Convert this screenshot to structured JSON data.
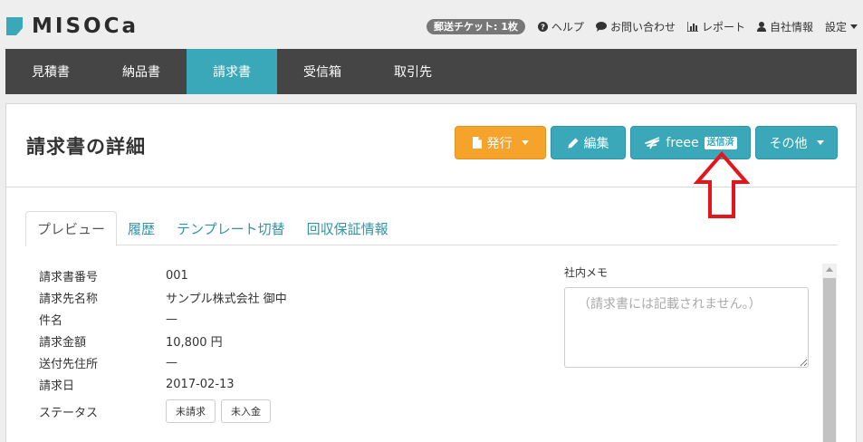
{
  "app": {
    "logo_text": "MISOCa",
    "brand_color": "#3aa8b8",
    "accent_color": "#f5a32b"
  },
  "topnav": {
    "ticket": "郵送チケット: 1枚",
    "items": [
      {
        "label": "ヘルプ",
        "icon": "question-circle-icon"
      },
      {
        "label": "お問い合わせ",
        "icon": "chat-bubble-icon"
      },
      {
        "label": "レポート",
        "icon": "bar-chart-icon"
      },
      {
        "label": "自社情報",
        "icon": "user-icon"
      },
      {
        "label": "設定",
        "icon": "caret-down-icon"
      }
    ]
  },
  "mainnav": {
    "tabs": [
      {
        "label": "見積書"
      },
      {
        "label": "納品書"
      },
      {
        "label": "請求書",
        "active": true
      },
      {
        "label": "受信箱"
      },
      {
        "label": "取引先"
      }
    ]
  },
  "page": {
    "title": "請求書の詳細",
    "buttons": {
      "issue": "発行",
      "edit": "編集",
      "freee": "freee",
      "freee_badge": "送信済",
      "more": "その他"
    }
  },
  "tabs": [
    {
      "label": "プレビュー",
      "active": true
    },
    {
      "label": "履歴"
    },
    {
      "label": "テンプレート切替"
    },
    {
      "label": "回収保証情報"
    }
  ],
  "details": {
    "rows": [
      {
        "label": "請求書番号",
        "value": "001"
      },
      {
        "label": "請求先名称",
        "value": "サンプル株式会社 御中"
      },
      {
        "label": "件名",
        "value": "—"
      },
      {
        "label": "請求金額",
        "value": "10,800 円"
      },
      {
        "label": "送付先住所",
        "value": "—"
      },
      {
        "label": "請求日",
        "value": "2017-02-13"
      }
    ],
    "status_label": "ステータス",
    "status_badges": [
      "未請求",
      "未入金"
    ]
  },
  "memo": {
    "label": "社内メモ",
    "placeholder": "（請求書には記載されません。）"
  }
}
